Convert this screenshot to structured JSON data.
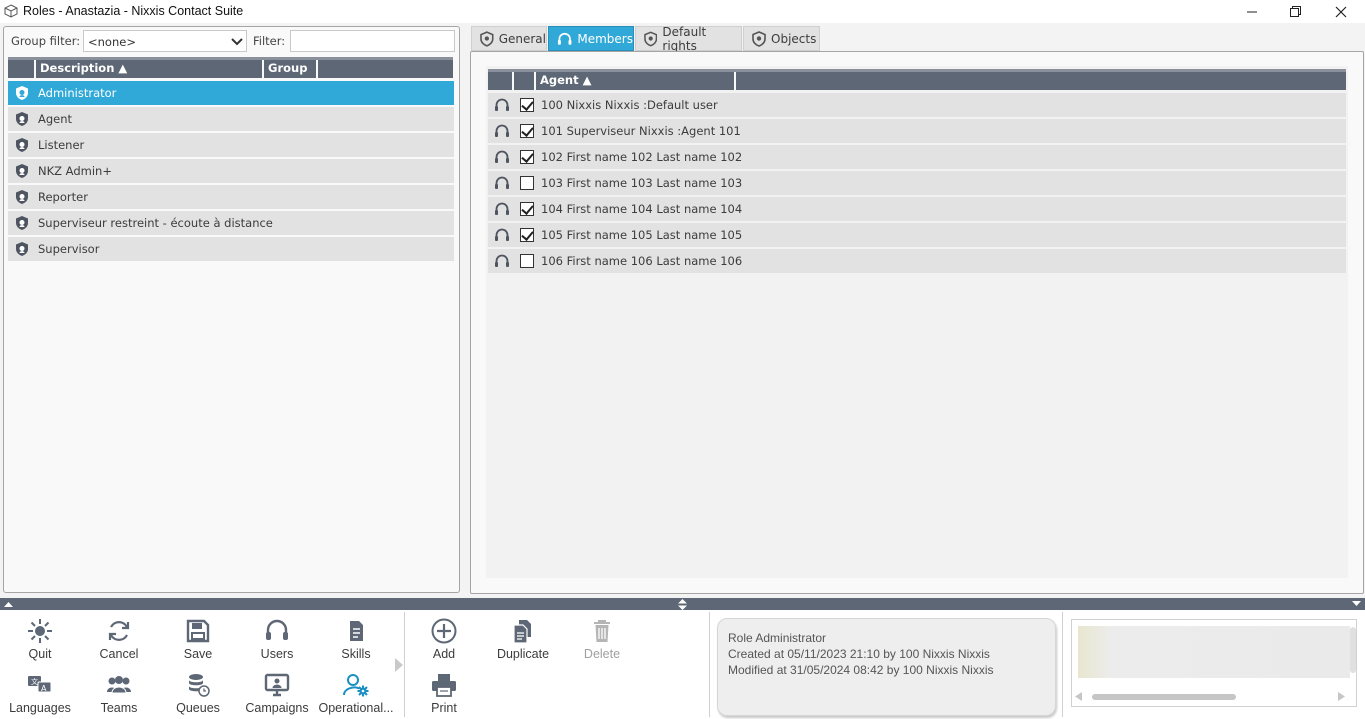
{
  "window": {
    "title": "Roles - Anastazia - Nixxis Contact Suite",
    "minimize": "–",
    "maximize": "❐",
    "close": "✕"
  },
  "left": {
    "group_filter_label": "Group filter:",
    "group_filter_value": "<none>",
    "filter_label": "Filter:",
    "filter_value": "",
    "columns": {
      "description": "Description ▲",
      "group": "Group"
    },
    "roles": [
      {
        "label": "Administrator",
        "selected": true
      },
      {
        "label": "Agent",
        "selected": false
      },
      {
        "label": "Listener",
        "selected": false
      },
      {
        "label": "NKZ Admin+",
        "selected": false
      },
      {
        "label": "Reporter",
        "selected": false
      },
      {
        "label": "Superviseur restreint - écoute à distance",
        "selected": false
      },
      {
        "label": "Supervisor",
        "selected": false
      }
    ]
  },
  "tabs": [
    {
      "label": "General",
      "active": false,
      "icon": "shield-icon"
    },
    {
      "label": "Members",
      "active": true,
      "icon": "headset-icon"
    },
    {
      "label": "Default rights",
      "active": false,
      "icon": "shield-icon"
    },
    {
      "label": "Objects",
      "active": false,
      "icon": "shield-icon"
    }
  ],
  "members": {
    "column_agent": "Agent ▲",
    "rows": [
      {
        "label": "100 Nixxis Nixxis :Default user",
        "checked": true
      },
      {
        "label": "101 Superviseur Nixxis :Agent 101",
        "checked": true
      },
      {
        "label": "102 First name 102 Last name 102",
        "checked": true
      },
      {
        "label": "103 First name 103 Last name 103",
        "checked": false
      },
      {
        "label": "104 First name 104 Last name 104",
        "checked": true
      },
      {
        "label": "105 First name 105 Last name 105",
        "checked": true
      },
      {
        "label": "106 First name 106 Last name 106",
        "checked": false
      }
    ]
  },
  "toolbar": {
    "nav": [
      {
        "label": "Quit",
        "icon": "quit-icon"
      },
      {
        "label": "Cancel",
        "icon": "refresh-icon"
      },
      {
        "label": "Save",
        "icon": "save-icon"
      },
      {
        "label": "Users",
        "icon": "headset-icon"
      },
      {
        "label": "Skills",
        "icon": "skills-icon"
      },
      {
        "label": "Languages",
        "icon": "languages-icon"
      },
      {
        "label": "Teams",
        "icon": "teams-icon"
      },
      {
        "label": "Queues",
        "icon": "queues-icon"
      },
      {
        "label": "Campaigns",
        "icon": "campaigns-icon"
      },
      {
        "label": "Operational...",
        "icon": "operational-icon"
      }
    ],
    "actions": [
      {
        "label": "Add",
        "icon": "add-icon",
        "enabled": true
      },
      {
        "label": "Duplicate",
        "icon": "duplicate-icon",
        "enabled": true
      },
      {
        "label": "Delete",
        "icon": "delete-icon",
        "enabled": false
      },
      {
        "label": "Print",
        "icon": "print-icon",
        "enabled": true
      }
    ]
  },
  "info": {
    "line1": "Role Administrator",
    "line2": "Created at 05/11/2023 21:10 by 100 Nixxis Nixxis",
    "line3": "Modified at 31/05/2024 08:42 by 100 Nixxis Nixxis"
  },
  "colors": {
    "accent": "#31a9d8",
    "header": "#5e6775",
    "row": "#e2e2e2"
  }
}
